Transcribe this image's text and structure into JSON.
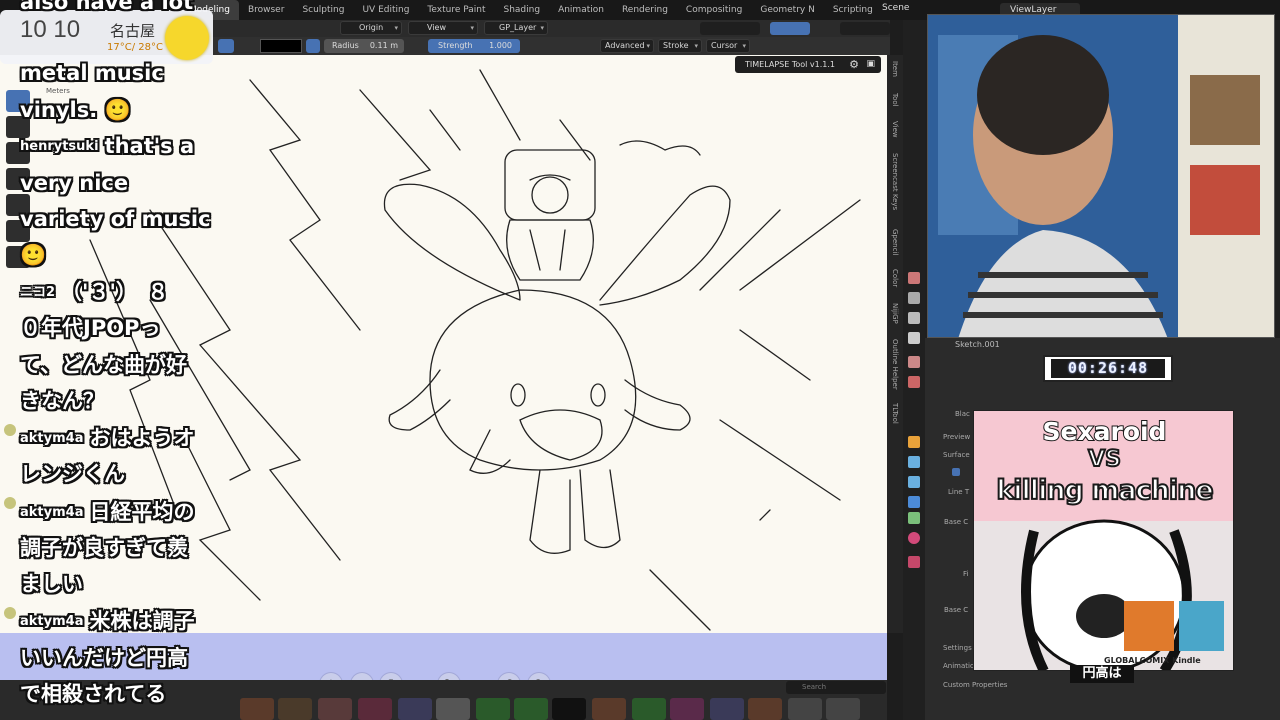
{
  "topbar": {
    "workspace_tabs": [
      "Modeling",
      "Browser",
      "Sculpting",
      "UV Editing",
      "Texture Paint",
      "Shading",
      "Animation",
      "Rendering",
      "Compositing",
      "Geometry N",
      "Scripting"
    ],
    "active_tab": "Modeling",
    "scene": "Scene",
    "view_layer": "ViewLayer"
  },
  "header": {
    "origin": "Origin",
    "view": "View",
    "layer": "GP_Layer"
  },
  "tool_settings": {
    "radius_label": "Radius",
    "radius_value": "0.11 m",
    "strength_label": "Strength",
    "strength_value": "1.000",
    "advanced": "Advanced",
    "stroke": "Stroke",
    "cursor": "Cursor"
  },
  "viewport": {
    "units_label": "Meters",
    "timelapse_tool": "TIMELAPSE Tool v1.1.1"
  },
  "n_panel_tabs": [
    "Item",
    "Tool",
    "View",
    "Screencast Keys",
    "Gpencil",
    "Color",
    "NijiGP",
    "Outline Helper",
    "TLTool"
  ],
  "properties": {
    "object_name": "Sketch.001",
    "material": "Blac",
    "preview": "Preview",
    "surface": "Surface",
    "line_type": "Line T",
    "base_color": "Base C",
    "fill": "Fi",
    "base_color2": "Base C",
    "settings": "Settings",
    "animation": "Animation",
    "custom_properties": "Custom Properties"
  },
  "timer": "00:26:48",
  "asset_search_placeholder": "Search",
  "weather": {
    "time": "10 10",
    "city": "名古屋",
    "temps": "17°C/ 28°C"
  },
  "comic_cover": {
    "title_top": "Sexaroid",
    "vs": "VS",
    "title_bottom": "killing machine",
    "brand": "GLOBALCOMIX Kindle",
    "caption": "円高は"
  },
  "chat": [
    {
      "user": "",
      "text": "also have a lot"
    },
    {
      "user": "",
      "text": "metal music"
    },
    {
      "user": "",
      "text": "vinyls. 🙂"
    },
    {
      "user": "henrytsuki",
      "text": "that's a"
    },
    {
      "user": "",
      "text": "very nice"
    },
    {
      "user": "",
      "text": "variety of music"
    },
    {
      "user": "",
      "text": "🙂"
    },
    {
      "user": "ニコ2",
      "text": "（'３'）　８"
    },
    {
      "user": "",
      "text": "０年代JPOPっ"
    },
    {
      "user": "",
      "text": "て、どんな曲が好"
    },
    {
      "user": "",
      "text": "きなん？"
    },
    {
      "user": "aktym4a",
      "text": "おはようオ"
    },
    {
      "user": "",
      "text": "レンジくん"
    },
    {
      "user": "aktym4a",
      "text": "日経平均の"
    },
    {
      "user": "",
      "text": "調子が良すぎて羨"
    },
    {
      "user": "",
      "text": "ましい"
    },
    {
      "user": "aktym4a",
      "text": "米株は調子"
    },
    {
      "user": "",
      "text": "いいんだけど円高"
    },
    {
      "user": "",
      "text": "で相殺されてる"
    }
  ]
}
